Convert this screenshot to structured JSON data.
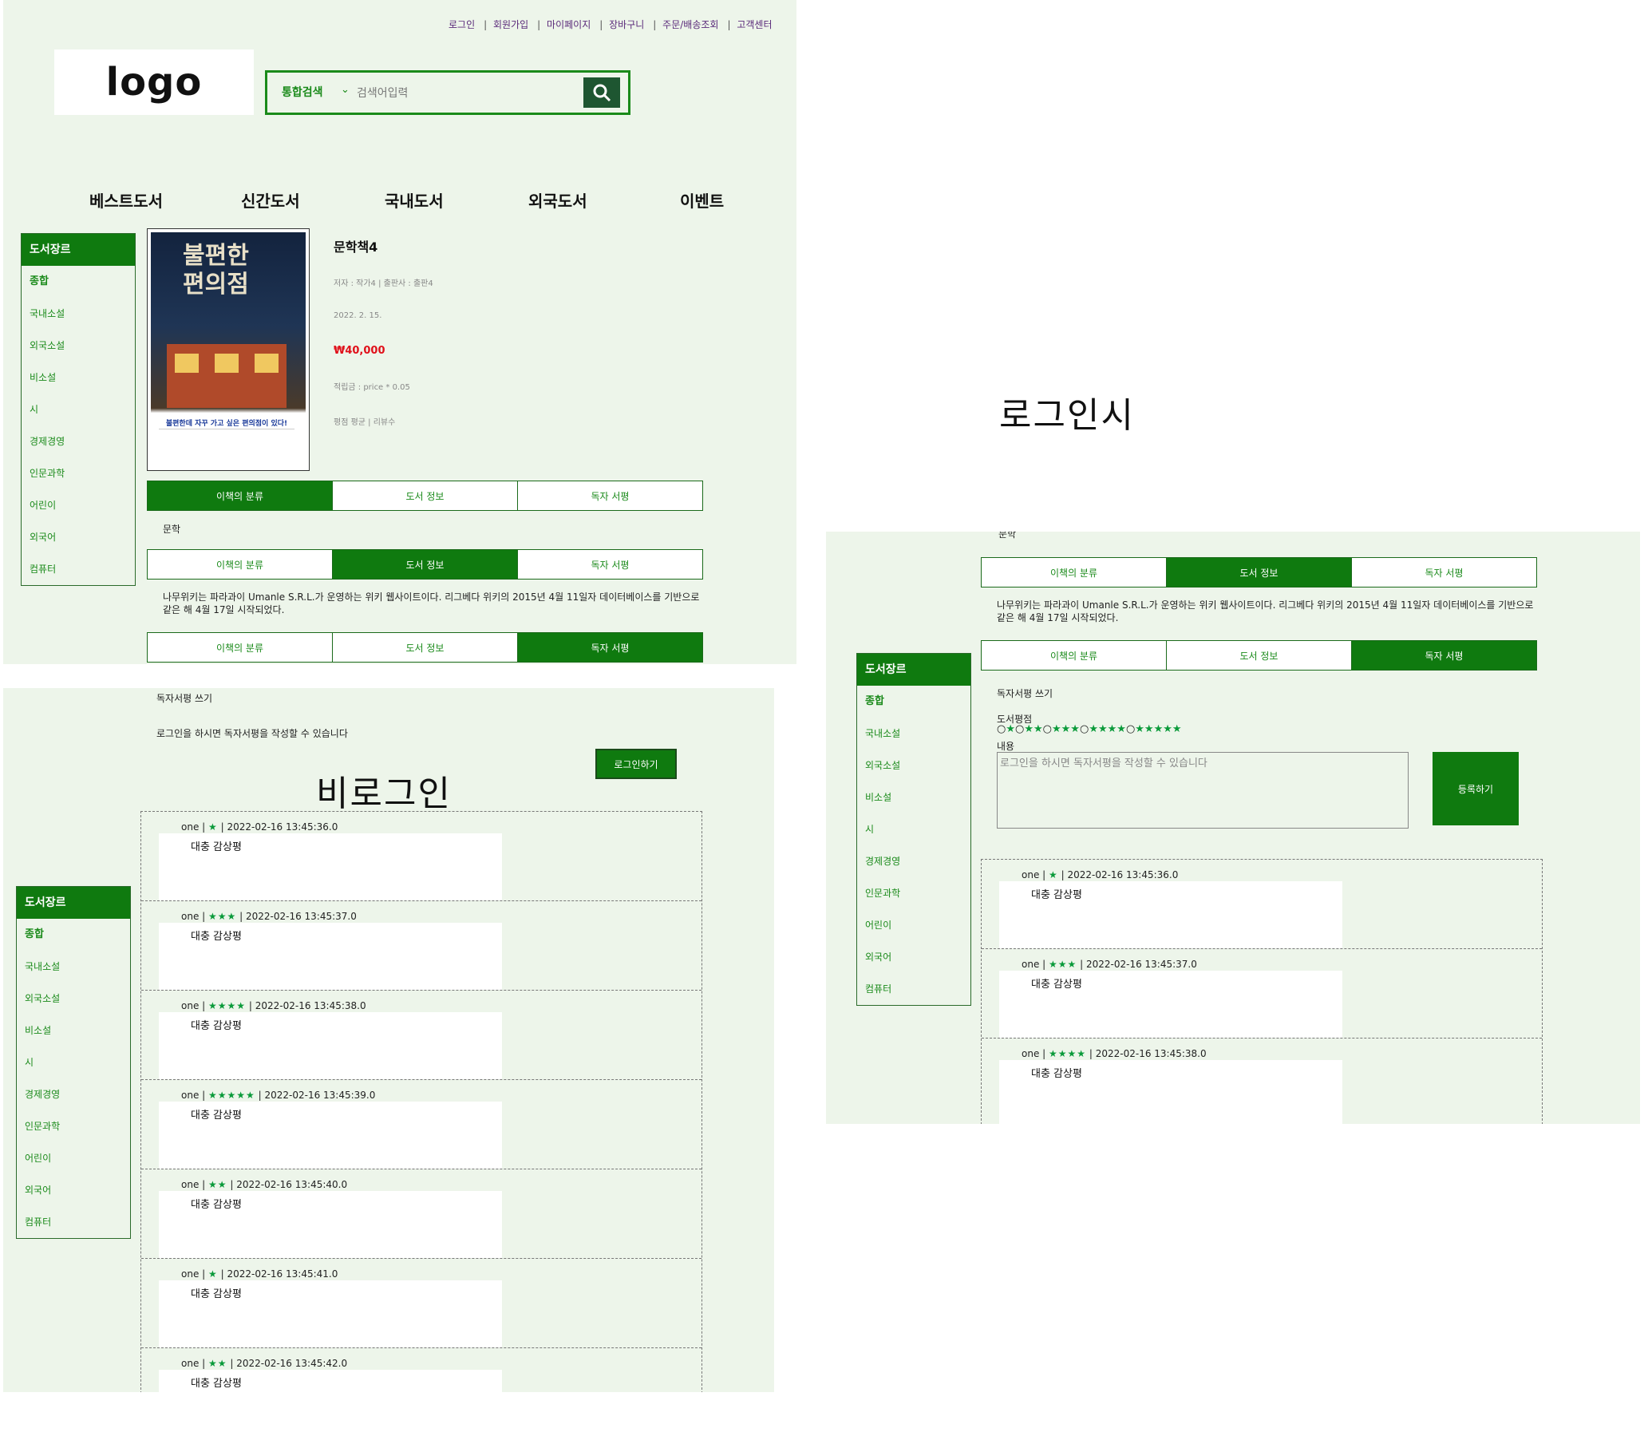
{
  "top_links": [
    "로그인",
    "회원가입",
    "마이페이지",
    "장바구니",
    "주문/배송조회",
    "고객센터"
  ],
  "logo_text": "logo",
  "search": {
    "category": "통합검색",
    "placeholder": "검색어입력"
  },
  "gnb": [
    "베스트도서",
    "신간도서",
    "국내도서",
    "외국도서",
    "이벤트"
  ],
  "sidebar": {
    "title": "도서장르",
    "items": [
      "종합",
      "국내소설",
      "외국소설",
      "비소설",
      "시",
      "경제경영",
      "인문과학",
      "어린이",
      "외국어",
      "컴퓨터"
    ]
  },
  "cover": {
    "title_line1": "불편한",
    "title_line2": "편의점",
    "caption": "불편한데 자꾸 가고 싶은 편의점이 있다!"
  },
  "book": {
    "title": "문학책4",
    "author_publisher": "저자 : 작가4 | 출판사 : 출판4",
    "date": "2022. 2. 15.",
    "price": "₩40,000",
    "points": "적립금 : price * 0.05",
    "rating": "평점 평균 | 리뷰수"
  },
  "tabs": [
    "이책의 분류",
    "도서 정보",
    "독자 서평"
  ],
  "classification": "문학",
  "description": "나무위키는 파라과이 Umanle S.R.L.가 운영하는 위키 웹사이트이다. 리그베다 위키의 2015년 4월 11일자 데이터베이스를 기반으로 같은 해 4월 17일 시작되었다.",
  "non_login": {
    "label": "비로그인",
    "write_title": "독자서평 쓰기",
    "notice": "로그인을 하시면 독자서평을 작성할 수 있습니다",
    "login_button": "로그인하기"
  },
  "login": {
    "label": "로그인시",
    "write_title": "독자서평 쓰기",
    "rating_label": "도서평점",
    "rating_options": [
      "★",
      "★★",
      "★★★",
      "★★★★",
      "★★★★★"
    ],
    "content_label": "내용",
    "textarea_placeholder": "로그인을 하시면 독자서평을 작성할 수 있습니다",
    "register_button": "등록하기"
  },
  "reviews": [
    {
      "user": "one",
      "stars": "★",
      "time": "2022-02-16 13:45:36.0",
      "text": "대충 감상평"
    },
    {
      "user": "one",
      "stars": "★★★",
      "time": "2022-02-16 13:45:37.0",
      "text": "대충 감상평"
    },
    {
      "user": "one",
      "stars": "★★★★",
      "time": "2022-02-16 13:45:38.0",
      "text": "대충 감상평"
    },
    {
      "user": "one",
      "stars": "★★★★★",
      "time": "2022-02-16 13:45:39.0",
      "text": "대충 감상평"
    },
    {
      "user": "one",
      "stars": "★★",
      "time": "2022-02-16 13:45:40.0",
      "text": "대충 감상평"
    },
    {
      "user": "one",
      "stars": "★",
      "time": "2022-02-16 13:45:41.0",
      "text": "대충 감상평"
    },
    {
      "user": "one",
      "stars": "★★",
      "time": "2022-02-16 13:45:42.0",
      "text": "대충 감상평"
    }
  ],
  "colors": {
    "accent": "#0f7a0f",
    "panel_bg": "#edf5ea",
    "price": "#e0101a",
    "star": "#0a9a3a"
  }
}
